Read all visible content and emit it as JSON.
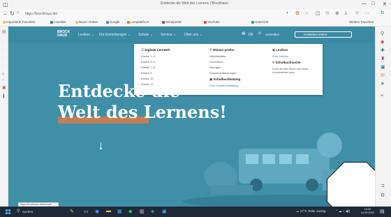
{
  "browser": {
    "tab_title": "Entdecke die Welt des Lernens | Brockhaus",
    "url": "https://brockhaus.de/",
    "tab_icon": "browser-tab-icon",
    "window_controls": [
      "—",
      "□",
      "✕"
    ]
  },
  "bookmarks": [
    {
      "label": "Importierte Favoriten",
      "color": "#f2c94c"
    },
    {
      "label": "Leseliste",
      "color": "#2b7fa0"
    },
    {
      "label": "Neuer Ordner",
      "color": "#f2c94c"
    },
    {
      "label": "Google",
      "color": "#4285f4"
    },
    {
      "label": "Lernplattform",
      "color": "#e67e22"
    },
    {
      "label": "Schulportal",
      "color": "#8e44ad"
    },
    {
      "label": "YouTube",
      "color": "#e74c3c"
    },
    {
      "label": "Unterricht",
      "color": "#27ae60"
    }
  ],
  "bookmarks_more": "Weitere Favoriten",
  "site": {
    "logo_line1": "BROCK",
    "logo_line2": "HAUS",
    "nav": [
      "Lexikon ⌄",
      "Für Einrichtungen ⌄",
      "Schule ⌄",
      "Service ⌄",
      "Über uns ⌄"
    ],
    "lang": "DE",
    "login": "Anmelden",
    "cta": "Kostenlos testen"
  },
  "megamenu": {
    "col1": {
      "heading": "Digitale Lernwelt",
      "items": [
        "Klasse 1–4",
        "Klasse 5–6",
        "Klasse 7–8",
        "Klasse 9",
        "Klasse 10",
        "Klasse 11"
      ]
    },
    "col2": {
      "heading": "Wissen prüfen",
      "items": [
        "Arbeitsblätter",
        "Lernvideos",
        "Übungen",
        "Zusammenfassungen"
      ],
      "heading2": "Schulbuchkatalog",
      "link": "Zum Schulbuchkatalog"
    },
    "col3": {
      "heading": "Lexikon",
      "link": "Zum Lexikon",
      "heading2": "Schulbuchsuche",
      "items": [
        "Such dir dein Buch und finde Lernmaterial dazu"
      ]
    }
  },
  "hero": {
    "line1": "Entdecke die",
    "line2": "Welt des Lernens!",
    "underline_color": "#d27c4a"
  },
  "status_bar_url": "https://brockhaus.de/lernwelt",
  "taskbar": {
    "search_placeholder": "Suchen",
    "weather": "17°C Teilw. sonnig",
    "clock_time": "10:32",
    "clock_date": "14.09.2023"
  },
  "colors": {
    "page_bg": "#3f8fa8",
    "header_bg": "#3a8aa4",
    "taskbar": "#1f2937"
  }
}
